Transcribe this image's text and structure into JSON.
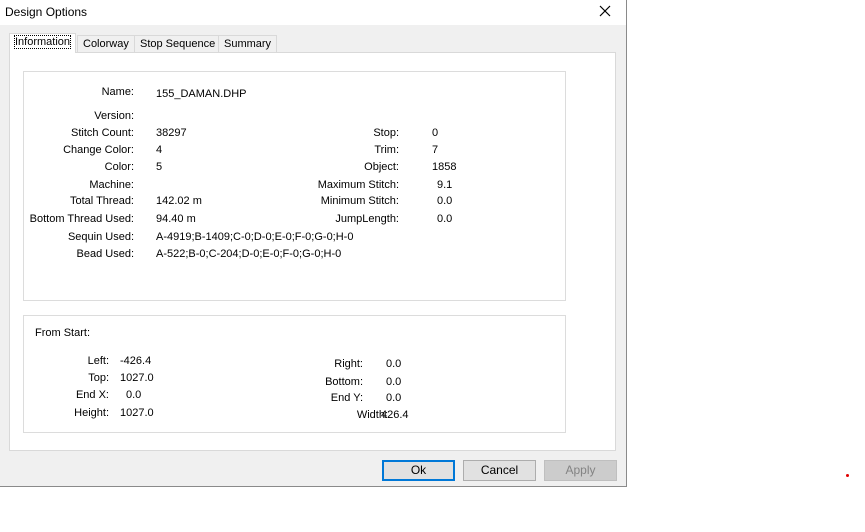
{
  "window": {
    "title": "Design Options"
  },
  "tabs": [
    {
      "label": "Information",
      "active": true
    },
    {
      "label": "Colorway",
      "active": false
    },
    {
      "label": "Stop Sequence",
      "active": false
    },
    {
      "label": "Summary",
      "active": false
    }
  ],
  "info": {
    "name_label": "Name:",
    "name_value": "155_DAMAN.DHP",
    "version_label": "Version:",
    "version_value": "",
    "stitch_count_label": "Stitch Count:",
    "stitch_count_value": "38297",
    "change_color_label": "Change Color:",
    "change_color_value": "4",
    "color_label": "Color:",
    "color_value": "5",
    "machine_label": "Machine:",
    "machine_value": "",
    "total_thread_label": "Total Thread:",
    "total_thread_value": "142.02 m",
    "bottom_thread_label": "Bottom Thread Used:",
    "bottom_thread_value": "94.40 m",
    "sequin_label": "Sequin Used:",
    "sequin_value": "A-4919;B-1409;C-0;D-0;E-0;F-0;G-0;H-0",
    "bead_label": "Bead Used:",
    "bead_value": "A-522;B-0;C-204;D-0;E-0;F-0;G-0;H-0",
    "stop_label": "Stop:",
    "stop_value": "0",
    "trim_label": "Trim:",
    "trim_value": "7",
    "object_label": "Object:",
    "object_value": "1858",
    "max_stitch_label": "Maximum Stitch:",
    "max_stitch_value": "9.1",
    "min_stitch_label": "Minimum Stitch:",
    "min_stitch_value": "0.0",
    "jump_length_label": "JumpLength:",
    "jump_length_value": "0.0"
  },
  "from_start": {
    "heading": "From Start:",
    "left_label": "Left:",
    "left_value": "-426.4",
    "top_label": "Top:",
    "top_value": "1027.0",
    "end_x_label": "End X:",
    "end_x_value": "0.0",
    "height_label": "Height:",
    "height_value": "1027.0",
    "right_label": "Right:",
    "right_value": "0.0",
    "bottom_label": "Bottom:",
    "bottom_value": "0.0",
    "end_y_label": "End Y:",
    "end_y_value": "0.0",
    "width_label": "Width:",
    "width_value": "426.4"
  },
  "buttons": {
    "ok": "Ok",
    "cancel": "Cancel",
    "apply": "Apply"
  },
  "icons": {
    "close": "close-icon"
  },
  "colors": {
    "default_button_border": "#0078d7",
    "dialog_background": "#f0f0f0",
    "marker_dot": "#e00000"
  }
}
